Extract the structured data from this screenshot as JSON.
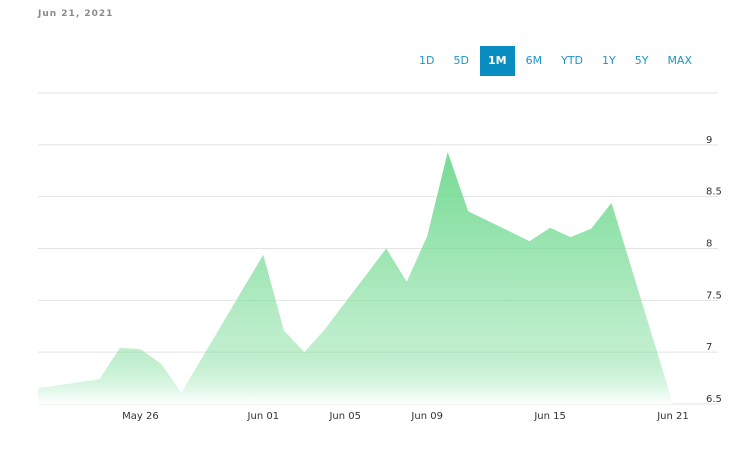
{
  "header": {
    "date": "Jun 21, 2021"
  },
  "ranges": [
    {
      "label": "1D",
      "active": false
    },
    {
      "label": "5D",
      "active": false
    },
    {
      "label": "1M",
      "active": true
    },
    {
      "label": "6M",
      "active": false
    },
    {
      "label": "YTD",
      "active": false
    },
    {
      "label": "1Y",
      "active": false
    },
    {
      "label": "5Y",
      "active": false
    },
    {
      "label": "MAX",
      "active": false
    }
  ],
  "colors": {
    "accent": "#0a8ec1",
    "area_top": "#6fd98f",
    "area_bottom": "#ffffff",
    "grid": "#e3e3e3"
  },
  "chart_data": {
    "type": "area",
    "x": [
      "2021-05-21",
      "2021-05-24",
      "2021-05-25",
      "2021-05-26",
      "2021-05-27",
      "2021-05-28",
      "2021-06-01",
      "2021-06-02",
      "2021-06-03",
      "2021-06-04",
      "2021-06-07",
      "2021-06-08",
      "2021-06-09",
      "2021-06-10",
      "2021-06-11",
      "2021-06-14",
      "2021-06-15",
      "2021-06-16",
      "2021-06-17",
      "2021-06-18",
      "2021-06-21"
    ],
    "values": [
      6.65,
      6.74,
      7.04,
      7.03,
      6.89,
      6.61,
      7.94,
      7.21,
      7.0,
      7.22,
      8.0,
      7.68,
      8.12,
      8.93,
      8.36,
      8.07,
      8.2,
      8.11,
      8.19,
      8.44
    ],
    "y_ticks": [
      "9",
      "8.5",
      "8",
      "7.5",
      "7",
      "6.5"
    ],
    "x_ticks": [
      "May 26",
      "Jun 01",
      "Jun 05",
      "Jun 09",
      "Jun 15",
      "Jun 21"
    ],
    "ylim": [
      6.5,
      9.5
    ],
    "grid": true
  }
}
